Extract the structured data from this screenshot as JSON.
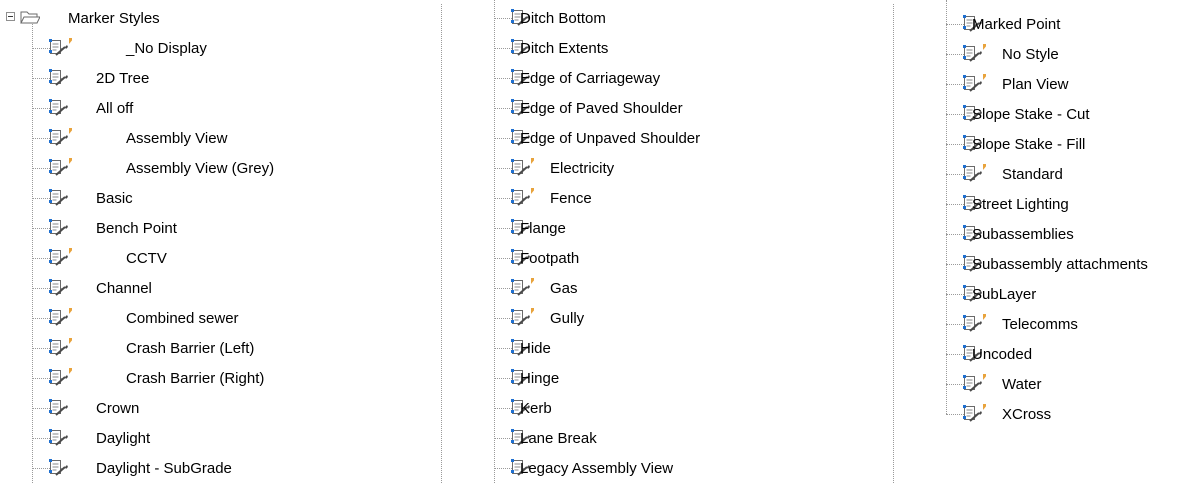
{
  "tree": {
    "root": {
      "label": "Marker Styles",
      "icon": "open-folder-icon"
    },
    "columns": [
      [
        {
          "label": "_No Display",
          "overridden": true
        },
        {
          "label": "2D Tree",
          "overridden": false
        },
        {
          "label": "All off",
          "overridden": false
        },
        {
          "label": "Assembly View",
          "overridden": true
        },
        {
          "label": "Assembly View (Grey)",
          "overridden": true
        },
        {
          "label": "Basic",
          "overridden": false
        },
        {
          "label": "Bench Point",
          "overridden": false
        },
        {
          "label": "CCTV",
          "overridden": true
        },
        {
          "label": "Channel",
          "overridden": false
        },
        {
          "label": "Combined sewer",
          "overridden": true
        },
        {
          "label": "Crash Barrier (Left)",
          "overridden": true
        },
        {
          "label": "Crash Barrier (Right)",
          "overridden": true
        },
        {
          "label": "Crown",
          "overridden": false
        },
        {
          "label": "Daylight",
          "overridden": false
        },
        {
          "label": "Daylight - SubGrade",
          "overridden": false
        }
      ],
      [
        {
          "label": "Ditch Bottom",
          "overridden": false
        },
        {
          "label": "Ditch Extents",
          "overridden": false
        },
        {
          "label": "Edge of Carriageway",
          "overridden": false
        },
        {
          "label": "Edge of Paved Shoulder",
          "overridden": false
        },
        {
          "label": "Edge of Unpaved Shoulder",
          "overridden": false
        },
        {
          "label": "Electricity",
          "overridden": true
        },
        {
          "label": "Fence",
          "overridden": true
        },
        {
          "label": "Flange",
          "overridden": false
        },
        {
          "label": "Footpath",
          "overridden": false
        },
        {
          "label": "Gas",
          "overridden": true
        },
        {
          "label": "Gully",
          "overridden": true
        },
        {
          "label": "Hide",
          "overridden": false
        },
        {
          "label": "Hinge",
          "overridden": false
        },
        {
          "label": "Kerb",
          "overridden": false
        },
        {
          "label": "Lane Break",
          "overridden": false
        },
        {
          "label": "Legacy Assembly View",
          "overridden": false
        }
      ],
      [
        {
          "label": "Marked Point",
          "overridden": false
        },
        {
          "label": "No Style",
          "overridden": true
        },
        {
          "label": "Plan View",
          "overridden": true
        },
        {
          "label": "Slope Stake - Cut",
          "overridden": false
        },
        {
          "label": "Slope Stake - Fill",
          "overridden": false
        },
        {
          "label": "Standard",
          "overridden": true
        },
        {
          "label": "Street Lighting",
          "overridden": false
        },
        {
          "label": "Subassemblies",
          "overridden": false
        },
        {
          "label": "Subassembly attachments",
          "overridden": false
        },
        {
          "label": "SubLayer",
          "overridden": false
        },
        {
          "label": "Telecomms",
          "overridden": true
        },
        {
          "label": "Uncoded",
          "overridden": false
        },
        {
          "label": "Water",
          "overridden": true
        },
        {
          "label": "XCross",
          "overridden": true
        }
      ]
    ],
    "icon_name": "style-item-icon",
    "override_flag_icon": "override-flag-icon",
    "colors": {
      "text": "#000000",
      "tree_lines": "#9a9a9a",
      "override_flag": "#e8a33c",
      "icon_accent": "#1e6fd0",
      "background": "#ffffff"
    }
  }
}
